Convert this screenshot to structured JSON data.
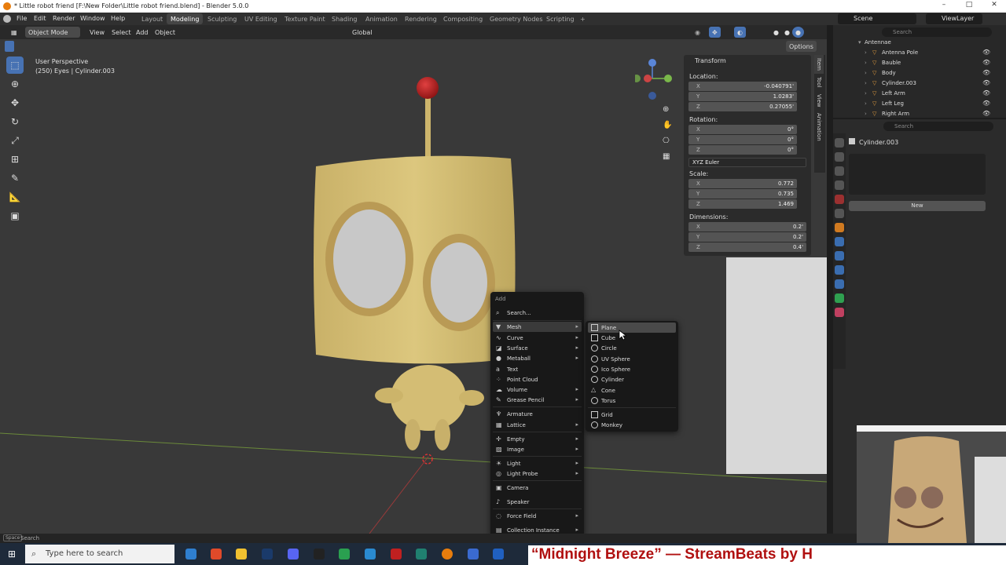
{
  "window": {
    "title": "* Little robot friend [F:\\New Folder\\Little robot friend.blend] - Blender 5.0.0",
    "controls": [
      "–",
      "□",
      "✕"
    ]
  },
  "menubar": {
    "items": [
      "File",
      "Edit",
      "Render",
      "Window",
      "Help"
    ],
    "workspaces": [
      "Layout",
      "Modeling",
      "Sculpting",
      "UV Editing",
      "Texture Paint",
      "Shading",
      "Animation",
      "Rendering",
      "Compositing",
      "Geometry Nodes",
      "Scripting"
    ],
    "active_workspace": "Modeling",
    "add_workspace": "+",
    "scene": "Scene",
    "view_layer": "ViewLayer"
  },
  "viewport_header": {
    "mode": "Object Mode",
    "menus": [
      "View",
      "Select",
      "Add",
      "Object"
    ],
    "transform_orientation": "Global",
    "options": "Options"
  },
  "viewport_info": {
    "view": "User Perspective",
    "object": "(250) Eyes | Cylinder.003"
  },
  "side_tabs": [
    "Item",
    "Tool",
    "View",
    "Animation"
  ],
  "transform_panel": {
    "title": "Transform",
    "location_label": "Location:",
    "location": [
      {
        "axis": "X",
        "value": "-0.040791'"
      },
      {
        "axis": "Y",
        "value": "1.0283'"
      },
      {
        "axis": "Z",
        "value": "0.27055'"
      }
    ],
    "rotation_label": "Rotation:",
    "rotation": [
      {
        "axis": "X",
        "value": "0°"
      },
      {
        "axis": "Y",
        "value": "0°"
      },
      {
        "axis": "Z",
        "value": "0°"
      }
    ],
    "rotation_mode": "XYZ Euler",
    "scale_label": "Scale:",
    "scale": [
      {
        "axis": "X",
        "value": "0.772"
      },
      {
        "axis": "Y",
        "value": "0.735"
      },
      {
        "axis": "Z",
        "value": "1.469"
      }
    ],
    "dimensions_label": "Dimensions:",
    "dimensions": [
      {
        "axis": "X",
        "value": "0.2'"
      },
      {
        "axis": "Y",
        "value": "0.2'"
      },
      {
        "axis": "Z",
        "value": "0.4'"
      }
    ]
  },
  "outliner": {
    "search_placeholder": "Search",
    "items": [
      "Antennae",
      "Antenna Pole",
      "Bauble",
      "Body",
      "Cylinder.003",
      "Left Arm",
      "Left Leg",
      "Right Arm"
    ]
  },
  "properties": {
    "search_placeholder": "Search",
    "object_name": "Cylinder.003",
    "new_button": "New"
  },
  "add_menu": {
    "title": "Add",
    "search": "Search...",
    "items": [
      {
        "label": "Mesh",
        "sub": true,
        "icon": "mesh-icon"
      },
      {
        "label": "Curve",
        "sub": true,
        "icon": "curve-icon"
      },
      {
        "label": "Surface",
        "sub": true,
        "icon": "surface-icon"
      },
      {
        "label": "Metaball",
        "sub": true,
        "icon": "metaball-icon"
      },
      {
        "label": "Text",
        "sub": false,
        "icon": "text-icon"
      },
      {
        "label": "Point Cloud",
        "sub": false,
        "icon": "point-cloud-icon"
      },
      {
        "label": "Volume",
        "sub": true,
        "icon": "volume-icon"
      },
      {
        "label": "Grease Pencil",
        "sub": true,
        "icon": "grease-pencil-icon"
      },
      {
        "label": "Armature",
        "sub": false,
        "icon": "armature-icon"
      },
      {
        "label": "Lattice",
        "sub": true,
        "icon": "lattice-icon"
      },
      {
        "label": "Empty",
        "sub": true,
        "icon": "empty-icon"
      },
      {
        "label": "Image",
        "sub": true,
        "icon": "image-icon"
      },
      {
        "label": "Light",
        "sub": true,
        "icon": "light-icon"
      },
      {
        "label": "Light Probe",
        "sub": true,
        "icon": "light-probe-icon"
      },
      {
        "label": "Camera",
        "sub": false,
        "icon": "camera-icon"
      },
      {
        "label": "Speaker",
        "sub": false,
        "icon": "speaker-icon"
      },
      {
        "label": "Force Field",
        "sub": true,
        "icon": "force-field-icon"
      },
      {
        "label": "Collection Instance",
        "sub": true,
        "icon": "collection-icon"
      }
    ]
  },
  "mesh_menu": {
    "items": [
      {
        "label": "Plane",
        "shape": "square"
      },
      {
        "label": "Cube",
        "shape": "square"
      },
      {
        "label": "Circle",
        "shape": "round"
      },
      {
        "label": "UV Sphere",
        "shape": "round"
      },
      {
        "label": "Ico Sphere",
        "shape": "round"
      },
      {
        "label": "Cylinder",
        "shape": "round"
      },
      {
        "label": "Cone",
        "shape": "tri"
      },
      {
        "label": "Torus",
        "shape": "round"
      },
      {
        "label": "Grid",
        "shape": "square"
      },
      {
        "label": "Monkey",
        "shape": "round"
      }
    ]
  },
  "statusbar": {
    "key": "Space",
    "action": "Search"
  },
  "taskbar": {
    "search_placeholder": "Type here to search"
  },
  "ticker_text": "“Midnight Breeze” — StreamBeats by H",
  "colors": {
    "accent": "#4772b3",
    "robot": "#d9c37a",
    "bauble": "#b8201f"
  }
}
